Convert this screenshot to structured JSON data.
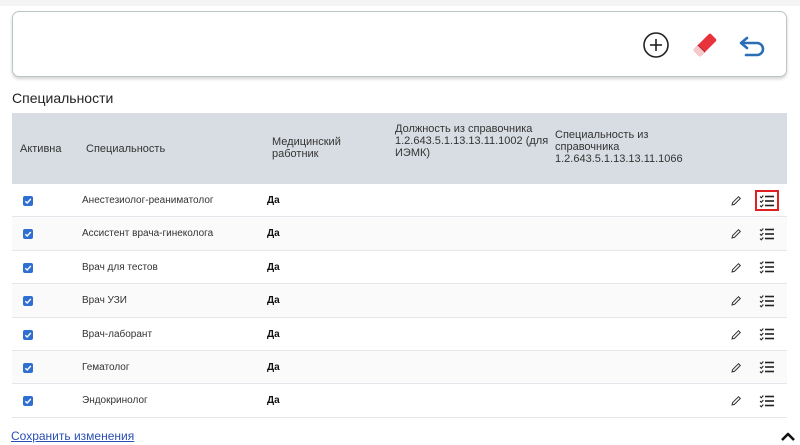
{
  "section": {
    "title": "Специальности"
  },
  "columns": {
    "active": "Активна",
    "specialty": "Специальность",
    "medical": "Медицинский работник",
    "position": "Должность из справочника 1.2.643.5.1.13.13.11.1002 (для ИЭМК)",
    "specialty_ref": "Специальность из справочника 1.2.643.5.1.13.13.11.1066"
  },
  "rows": [
    {
      "active": true,
      "specialty": "Анестезиолог-реаниматолог",
      "medical": "Да"
    },
    {
      "active": true,
      "specialty": "Ассистент врача-гинеколога",
      "medical": "Да"
    },
    {
      "active": true,
      "specialty": "Врач для тестов",
      "medical": "Да"
    },
    {
      "active": true,
      "specialty": "Врач УЗИ",
      "medical": "Да"
    },
    {
      "active": true,
      "specialty": "Врач-лаборант",
      "medical": "Да"
    },
    {
      "active": true,
      "specialty": "Гематолог",
      "medical": "Да"
    },
    {
      "active": true,
      "specialty": "Эндокринолог",
      "medical": "Да"
    }
  ],
  "footer": {
    "save_link": "Сохранить изменения"
  },
  "icons": {
    "add": "plus-circle-icon",
    "erase": "eraser-icon",
    "undo": "undo-arrow-icon",
    "edit": "pencil-icon",
    "list": "checklist-icon",
    "scroll": "chevron-up-icon"
  },
  "colors": {
    "header_bg": "#d8dde3",
    "checkbox": "#2f6fd0",
    "eraser": "#e8323c",
    "undo": "#2a6fb5",
    "highlight": "#e02020",
    "link": "#2a4fb5"
  }
}
